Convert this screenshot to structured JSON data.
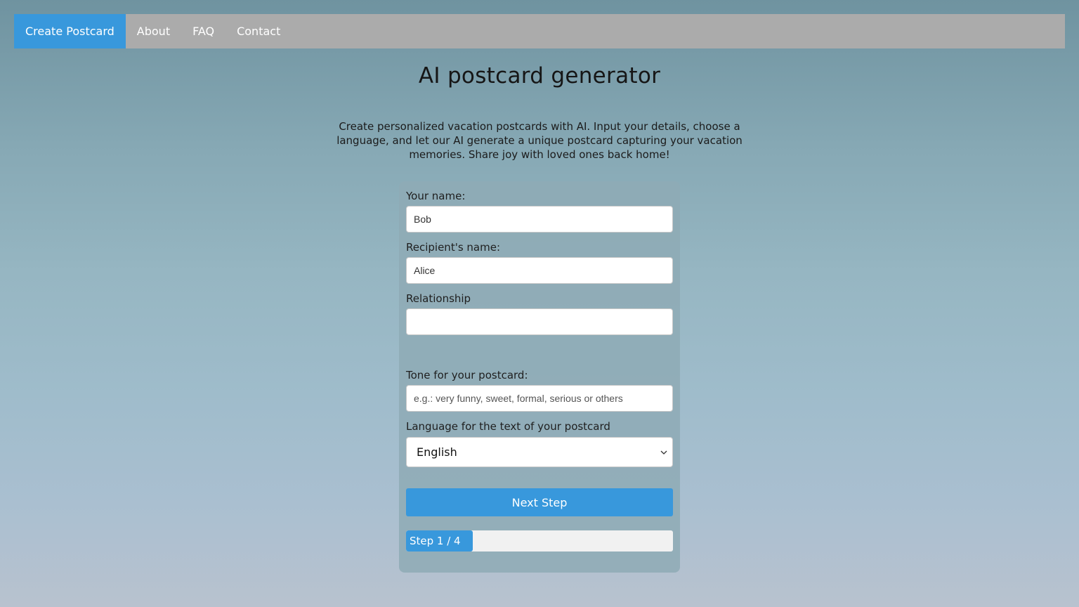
{
  "nav": {
    "items": [
      {
        "label": "Create Postcard",
        "active": true
      },
      {
        "label": "About",
        "active": false
      },
      {
        "label": "FAQ",
        "active": false
      },
      {
        "label": "Contact",
        "active": false
      }
    ]
  },
  "page": {
    "title": "AI postcard generator",
    "intro": "Create personalized vacation postcards with AI. Input your details, choose a language, and let our AI generate a unique postcard capturing your vacation memories. Share joy with loved ones back home!"
  },
  "form": {
    "your_name": {
      "label": "Your name:",
      "value": "Bob",
      "placeholder": ""
    },
    "recipient_name": {
      "label": "Recipient's name:",
      "value": "Alice",
      "placeholder": ""
    },
    "relationship": {
      "label": "Relationship",
      "value": "",
      "placeholder": ""
    },
    "tone": {
      "label": "Tone for your postcard:",
      "value": "",
      "placeholder": "e.g.: very funny, sweet, formal, serious or others"
    },
    "language": {
      "label": "Language for the text of your postcard",
      "selected": "English",
      "icon": "chevron-down-icon"
    },
    "next_button": "Next Step"
  },
  "progress": {
    "label": "Step 1 / 4",
    "current_step": 1,
    "total_steps": 4
  },
  "colors": {
    "accent": "#3898dc",
    "nav_background": "#ababab"
  }
}
